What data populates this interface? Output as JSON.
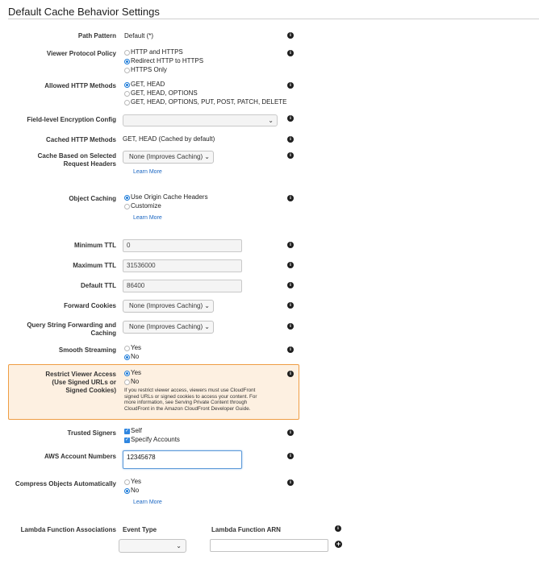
{
  "section_title": "Default Cache Behavior Settings",
  "info_glyph": "i",
  "path_pattern": {
    "label": "Path Pattern",
    "value": "Default (*)"
  },
  "viewer_protocol": {
    "label": "Viewer Protocol Policy",
    "options": [
      "HTTP and HTTPS",
      "Redirect HTTP to HTTPS",
      "HTTPS Only"
    ],
    "selected": "Redirect HTTP to HTTPS"
  },
  "allowed_methods": {
    "label": "Allowed HTTP Methods",
    "options": [
      "GET, HEAD",
      "GET, HEAD, OPTIONS",
      "GET, HEAD, OPTIONS, PUT, POST, PATCH, DELETE"
    ],
    "selected": "GET, HEAD"
  },
  "field_encryption": {
    "label": "Field-level Encryption Config",
    "value": ""
  },
  "cached_methods": {
    "label": "Cached HTTP Methods",
    "value": "GET, HEAD (Cached by default)"
  },
  "cache_headers": {
    "label_line1": "Cache Based on Selected",
    "label_line2": "Request Headers",
    "value": "None (Improves Caching)",
    "learn_more": "Learn More"
  },
  "object_caching": {
    "label": "Object Caching",
    "options": [
      "Use Origin Cache Headers",
      "Customize"
    ],
    "selected": "Use Origin Cache Headers",
    "learn_more": "Learn More"
  },
  "ttl": {
    "min_label": "Minimum TTL",
    "min_value": "0",
    "max_label": "Maximum TTL",
    "max_value": "31536000",
    "default_label": "Default TTL",
    "default_value": "86400"
  },
  "forward_cookies": {
    "label": "Forward Cookies",
    "value": "None (Improves Caching)"
  },
  "query_string": {
    "label_line1": "Query String Forwarding and",
    "label_line2": "Caching",
    "value": "None (Improves Caching)"
  },
  "smooth_streaming": {
    "label": "Smooth Streaming",
    "options": [
      "Yes",
      "No"
    ],
    "selected": "No"
  },
  "restrict_viewer": {
    "label_line1": "Restrict Viewer Access",
    "label_line2": "(Use Signed URLs or",
    "label_line3": "Signed Cookies)",
    "options": [
      "Yes",
      "No"
    ],
    "selected": "Yes",
    "note": "If you restrict viewer access, viewers must use CloudFront signed URLs or signed cookies to access your content. For more information, see Serving Private Content through CloudFront in the Amazon CloudFront Developer Guide."
  },
  "trusted_signers": {
    "label": "Trusted Signers",
    "options": [
      "Self",
      "Specify Accounts"
    ],
    "checked": [
      "Self",
      "Specify Accounts"
    ]
  },
  "aws_accounts": {
    "label": "AWS Account Numbers",
    "value": "12345678"
  },
  "compress": {
    "label": "Compress Objects Automatically",
    "options": [
      "Yes",
      "No"
    ],
    "selected": "No",
    "learn_more": "Learn More"
  },
  "lambda": {
    "label": "Lambda Function Associations",
    "event_type_header": "Event Type",
    "arn_header": "Lambda Function ARN",
    "add_glyph": "+"
  },
  "colors": {
    "accent": "#2f86e0",
    "link": "#1a66c2",
    "warning_bg": "#fdf0e1",
    "warning_border": "#ef9d43"
  },
  "icons": [
    "info-icon",
    "chevron-down-icon",
    "add-icon",
    "radio-icon",
    "checkbox-icon"
  ]
}
